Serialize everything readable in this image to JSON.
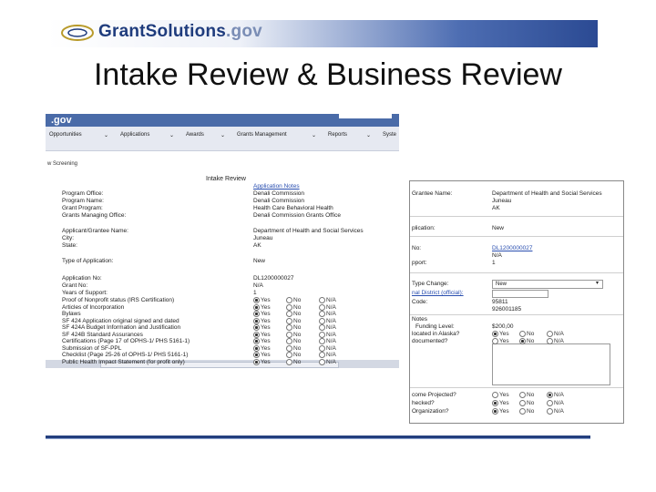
{
  "header": {
    "brand": "GrantSolutions",
    "domain": ".gov"
  },
  "slide": {
    "title": "Intake Review & Business Review"
  },
  "left": {
    "gov": ".gov",
    "nav": [
      "Opportunities",
      "Applications",
      "Awards",
      "Grants Management",
      "Reports",
      "Syste"
    ],
    "breadcrumb": "w Screening",
    "form_title": "Intake Review",
    "section_link": "Application Notes",
    "rows": [
      {
        "label": "Program Office:",
        "value": "Denali Commission"
      },
      {
        "label": "Program Name:",
        "value": "Denali Commission"
      },
      {
        "label": "Grant Program:",
        "value": "Health Care Behavioral Health"
      },
      {
        "label": "Grants Managing Office:",
        "value": "Denali Commission Grants Office"
      }
    ],
    "applicant": [
      {
        "label": "Applicant/Grantee Name:",
        "value": "Department of Health and Social Services"
      },
      {
        "label": "City:",
        "value": "Juneau"
      },
      {
        "label": "State:",
        "value": "AK"
      }
    ],
    "type": {
      "label": "Type of Application:",
      "value": "New"
    },
    "appno": [
      {
        "label": "Application No:",
        "value": "DL1200000027"
      },
      {
        "label": "Grant No:",
        "value": "N/A"
      },
      {
        "label": "Years of Support:",
        "value": "1"
      }
    ],
    "opt_yes": "Yes",
    "opt_no": "No",
    "opt_na": "N/A",
    "checks": [
      {
        "label": "Proof of Nonprofit status (IRS Certification)",
        "sel": "yes"
      },
      {
        "label": "Articles of Incorporation",
        "sel": "yes"
      },
      {
        "label": "Bylaws",
        "sel": "yes"
      },
      {
        "label": "SF 424 Application original signed and dated",
        "sel": "yes"
      },
      {
        "label": "SF 424A Budget Information and Justification",
        "sel": "yes"
      },
      {
        "label": "SF 424B Standard Assurances",
        "sel": "yes"
      },
      {
        "label": "Certifications (Page 17 of OPHS-1/ PHS 5161-1)",
        "sel": "yes"
      },
      {
        "label": "Submission of SF-PPL",
        "sel": "yes"
      },
      {
        "label": "Checklist (Page 25-26 of OPHS-1/ PHS 5161-1)",
        "sel": "yes"
      },
      {
        "label": "Public Health Impact Statement (for profit only)",
        "sel": "yes"
      }
    ]
  },
  "right": {
    "grantee_label": "Grantee Name:",
    "grantee_value": "Department of Health and Social Services",
    "city_value": "Juneau",
    "state_value": "AK",
    "app_label": "plication:",
    "app_value": "New",
    "no_label": "No:",
    "no_value": "DL1200000027",
    "na_value": "N/A",
    "pport_label": "pport:",
    "pport_value": "1",
    "typechange_label": "Type Change:",
    "typechange_value": "New",
    "district_label": "nal District (official):",
    "code_label": "Code:",
    "code_value": "95811",
    "code2_value": "926001185",
    "notes_label": "Notes",
    "funding_label": "Funding Level:",
    "funding_value": "$200,00",
    "q1_label": "located in Alaska?",
    "q2_label": "documented?",
    "income_label": "come Projected?",
    "checked_label": "hecked?",
    "org_label": "Organization?",
    "opt_yes": "Yes",
    "opt_no": "No",
    "opt_na": "N/A"
  }
}
